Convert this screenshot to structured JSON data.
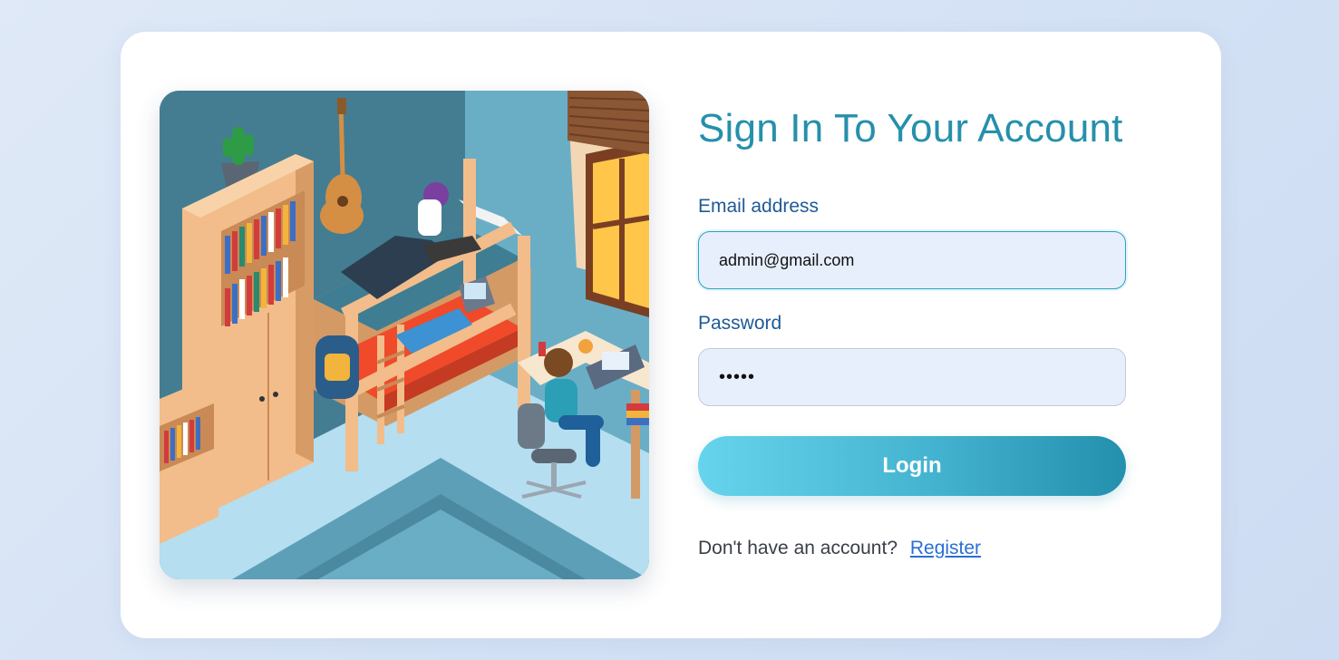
{
  "page": {
    "title": "Sign In To Your Account"
  },
  "illustration": {
    "icon": "dorm-room-illustration",
    "colors": {
      "wall": "#6aaec6",
      "wall_dark": "#3f7d93",
      "floor": "#b5def0",
      "wood": "#f2bd8a",
      "blanket": "#f04a2b"
    }
  },
  "form": {
    "email_label": "Email address",
    "email_value": "admin@gmail.com",
    "password_label": "Password",
    "password_value": "12345",
    "login_label": "Login",
    "register_prompt": "Don't have an account?",
    "register_link": "Register"
  },
  "colors": {
    "accent": "#2590ab",
    "label": "#1f5a96",
    "link": "#2a6fd6",
    "input_bg": "#e7effc"
  }
}
